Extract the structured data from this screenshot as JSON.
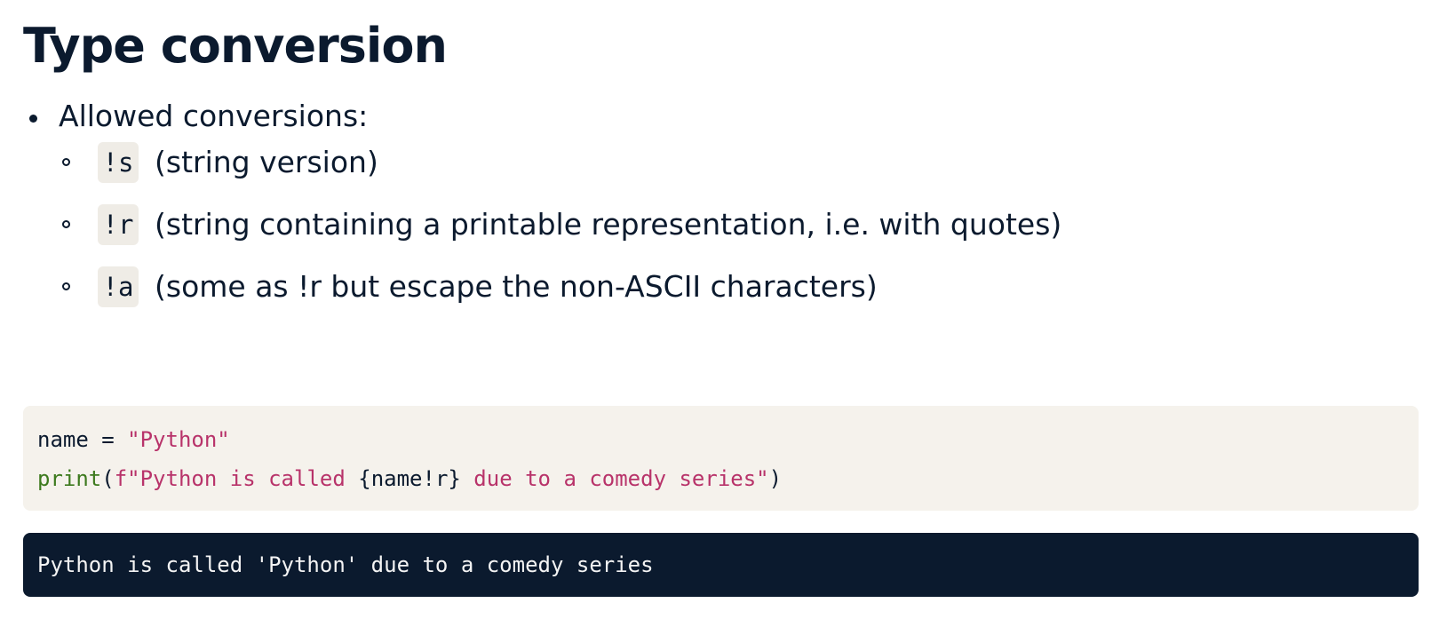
{
  "page": {
    "title": "Type conversion"
  },
  "bullets": {
    "main": "Allowed conversions:",
    "sub": [
      {
        "code": "!s",
        "text": "(string version)"
      },
      {
        "code": "!r",
        "text": "(string containing a printable representation, i.e. with quotes)"
      },
      {
        "code": "!a",
        "text": "(some as !r but escape the non-ASCII characters)"
      }
    ]
  },
  "code": {
    "line1": {
      "var": "name",
      "op": " = ",
      "str": "\"Python\""
    },
    "line2": {
      "func": "print",
      "open": "(",
      "str1": "f\"Python is called ",
      "expr": "{name!r}",
      "str2": " due to a comedy series\"",
      "close": ")"
    }
  },
  "output": {
    "text": "Python is called 'Python' due to a comedy series"
  },
  "colors": {
    "text": "#0b1a2e",
    "code_bg": "#f5f2ec",
    "chip_bg": "#efece6",
    "string": "#b8336a",
    "builtin": "#3d7a1e",
    "output_bg": "#0b1a2e",
    "output_text": "#f4f4f4"
  }
}
